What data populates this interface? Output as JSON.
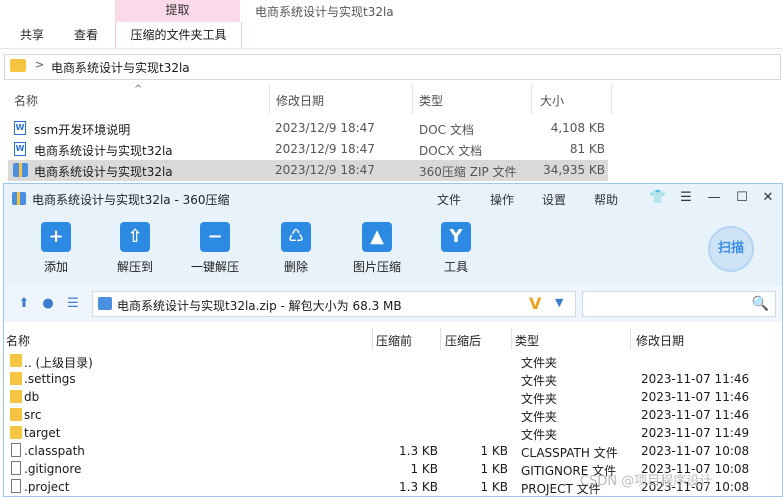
{
  "explorer": {
    "window_title": "电商系统设计与实现t32la",
    "ribbon": {
      "tabs": [
        "共享",
        "查看"
      ],
      "context_top": "提取",
      "context_tab": "压缩的文件夹工具"
    },
    "address": {
      "chevron": ">",
      "path": "电商系统设计与实现t32la"
    },
    "columns": {
      "name": "名称",
      "modified": "修改日期",
      "type": "类型",
      "size": "大小"
    },
    "files": [
      {
        "name": "ssm开发环境说明",
        "modified": "2023/12/9 18:47",
        "type": "DOC 文档",
        "size": "4,108 KB",
        "icon": "word-doc-icon"
      },
      {
        "name": "电商系统设计与实现t32la",
        "modified": "2023/12/9 18:47",
        "type": "DOCX 文档",
        "size": "81 KB",
        "icon": "word-docx-icon"
      },
      {
        "name": "电商系统设计与实现t32la",
        "modified": "2023/12/9 18:47",
        "type": "360压缩 ZIP 文件",
        "size": "34,935 KB",
        "icon": "zip-icon",
        "selected": true
      }
    ]
  },
  "zip": {
    "title": "电商系统设计与实现t32la - 360压缩",
    "menu": [
      "文件",
      "操作",
      "设置",
      "帮助"
    ],
    "window_buttons": {
      "shirt": "👕",
      "menu": "☰",
      "minimize": "—",
      "maximize": "☐",
      "close": "✕"
    },
    "tools": [
      {
        "label": "添加",
        "glyph": "+"
      },
      {
        "label": "解压到",
        "glyph": "⇧"
      },
      {
        "label": "一键解压",
        "glyph": "−"
      },
      {
        "label": "删除",
        "glyph": "♺"
      },
      {
        "label": "图片压缩",
        "glyph": "▲"
      },
      {
        "label": "工具",
        "glyph": "Y"
      }
    ],
    "scan_label": "扫描",
    "nav": {
      "up": "⬆",
      "info": "●",
      "list": "☰"
    },
    "path": "电商系统设计与实现t32la.zip - 解包大小为 68.3 MB",
    "path_v": "V",
    "path_dropdown": "▼",
    "search_icon": "🔍",
    "columns": {
      "name": "名称",
      "before": "压缩前",
      "after": "压缩后",
      "type": "类型",
      "modified": "修改日期"
    },
    "rows": [
      {
        "name": ".. (上级目录)",
        "before": "",
        "after": "",
        "type": "文件夹",
        "modified": "",
        "kind": "folder"
      },
      {
        "name": ".settings",
        "before": "",
        "after": "",
        "type": "文件夹",
        "modified": "2023-11-07 11:46",
        "kind": "folder"
      },
      {
        "name": "db",
        "before": "",
        "after": "",
        "type": "文件夹",
        "modified": "2023-11-07 11:46",
        "kind": "folder"
      },
      {
        "name": "src",
        "before": "",
        "after": "",
        "type": "文件夹",
        "modified": "2023-11-07 11:46",
        "kind": "folder"
      },
      {
        "name": "target",
        "before": "",
        "after": "",
        "type": "文件夹",
        "modified": "2023-11-07 11:49",
        "kind": "folder"
      },
      {
        "name": ".classpath",
        "before": "1.3 KB",
        "after": "1 KB",
        "type": "CLASSPATH 文件",
        "modified": "2023-11-07 10:08",
        "kind": "file"
      },
      {
        "name": ".gitignore",
        "before": "1 KB",
        "after": "1 KB",
        "type": "GITIGNORE 文件",
        "modified": "2023-11-07 10:08",
        "kind": "file"
      },
      {
        "name": ".project",
        "before": "1.3 KB",
        "after": "1 KB",
        "type": "PROJECT 文件",
        "modified": "2023-11-07 10:08",
        "kind": "file"
      }
    ]
  },
  "watermark": "CSDN @项目程序设计"
}
